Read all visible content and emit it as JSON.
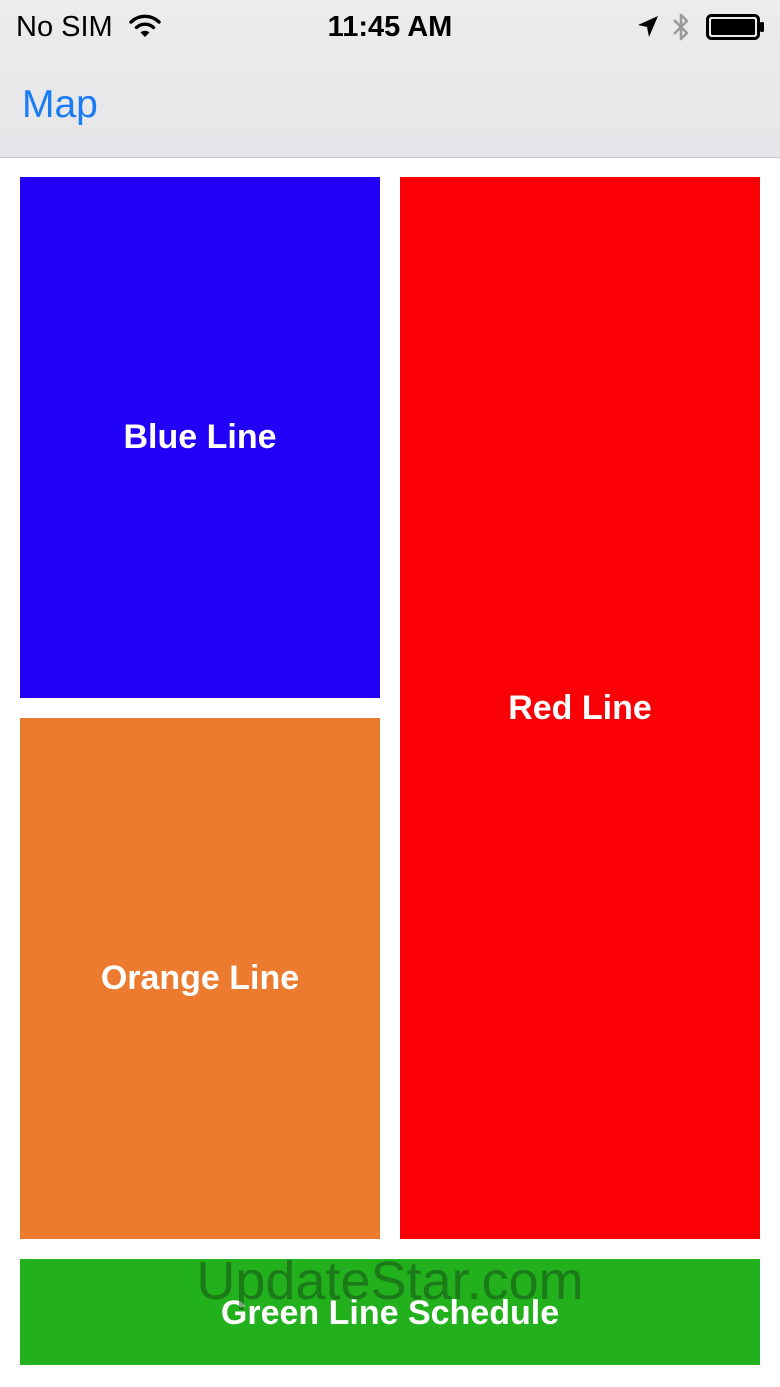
{
  "status_bar": {
    "carrier": "No SIM",
    "time": "11:45 AM",
    "icons": [
      "wifi-icon",
      "location-icon",
      "bluetooth-icon",
      "battery-icon"
    ]
  },
  "nav_bar": {
    "back_label": "Map",
    "accent_color": "#1a7cf5"
  },
  "tiles": [
    {
      "label": "Blue Line",
      "color": "#2200f7"
    },
    {
      "label": "Red Line",
      "color": "#fa0006"
    },
    {
      "label": "Orange Line",
      "color": "#ec7a2f"
    },
    {
      "label": "Green Line Schedule",
      "color": "#22b01d"
    }
  ],
  "watermark": "UpdateStar.com"
}
